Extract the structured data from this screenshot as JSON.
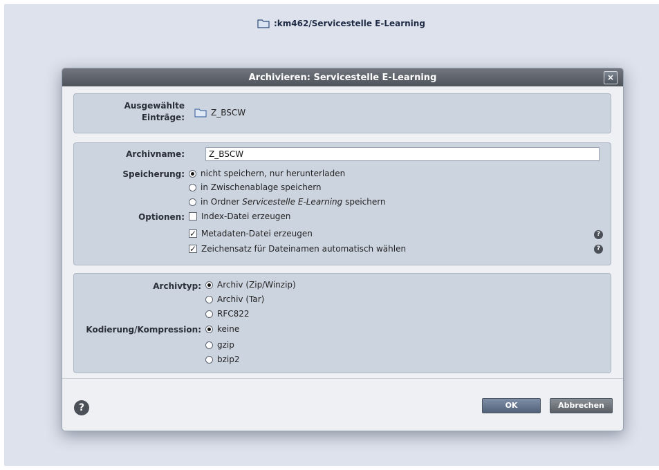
{
  "page": {
    "path": ":km462/Servicestelle E-Learning"
  },
  "dialog": {
    "title": "Archivieren: Servicestelle E-Learning",
    "close": "×",
    "selected": {
      "label_line1": "Ausgewählte",
      "label_line2": "Einträge:",
      "item": "Z_BSCW"
    },
    "archivename": {
      "label": "Archivname:",
      "value": "Z_BSCW"
    },
    "speicherung": {
      "label": "Speicherung:",
      "options": [
        "nicht speichern, nur herunterladen",
        "in Zwischenablage speichern"
      ],
      "folder_prefix": "in Ordner ",
      "folder_name": "Servicestelle E-Learning",
      "folder_suffix": " speichern",
      "selected_index": 0
    },
    "optionen": {
      "label": "Optionen:",
      "items": [
        {
          "text": "Index-Datei erzeugen",
          "checked": false
        },
        {
          "text": "Metadaten-Datei erzeugen",
          "checked": true
        },
        {
          "text": "Zeichensatz für Dateinamen automatisch wählen",
          "checked": true
        }
      ]
    },
    "archivtyp": {
      "label": "Archivtyp:",
      "options": [
        "Archiv (Zip/Winzip)",
        "Archiv (Tar)",
        "RFC822"
      ],
      "selected_index": 0
    },
    "kodierung": {
      "label": "Kodierung/Kompression:",
      "options": [
        "keine",
        "gzip",
        "bzip2"
      ],
      "selected_index": 0
    },
    "buttons": {
      "ok": "OK",
      "cancel": "Abbrechen",
      "help": "?"
    },
    "help_symbol": "?"
  }
}
